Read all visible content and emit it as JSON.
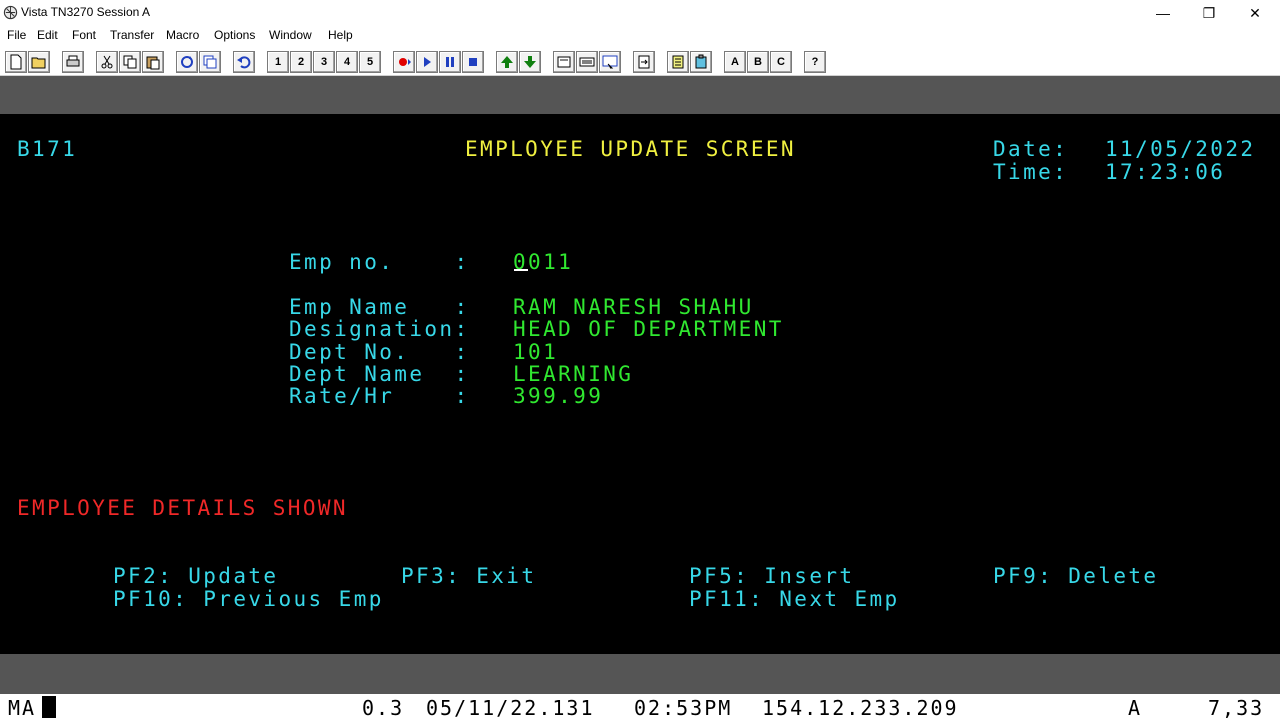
{
  "window": {
    "title": "Vista TN3270 Session A",
    "minimize": "—",
    "restore": "❐",
    "close": "✕"
  },
  "menu": [
    "File",
    "Edit",
    "Font",
    "Transfer",
    "Macro",
    "Options",
    "Window",
    "Help"
  ],
  "toolbar": {
    "macro_buttons": [
      "1",
      "2",
      "3",
      "4",
      "5"
    ],
    "letter_buttons": [
      "A",
      "B",
      "C"
    ],
    "help_button": "?"
  },
  "screen": {
    "transaction_id": "B171",
    "title": "EMPLOYEE UPDATE SCREEN",
    "date_label": "Date:",
    "date_value": "11/05/2022",
    "time_label": "Time:",
    "time_value": "17:23:06",
    "fields": [
      {
        "label": "Emp no.    :",
        "value": "0011"
      },
      {
        "label": "Emp Name   :",
        "value": "RAM NARESH SHAHU"
      },
      {
        "label": "Designation:",
        "value": "HEAD OF DEPARTMENT"
      },
      {
        "label": "Dept No.   :",
        "value": "101"
      },
      {
        "label": "Dept Name  :",
        "value": "LEARNING"
      },
      {
        "label": "Rate/Hr    :",
        "value": "399.99"
      }
    ],
    "message": "EMPLOYEE DETAILS SHOWN",
    "pf_keys": [
      "PF2: Update",
      "PF3: Exit",
      "PF5: Insert",
      "PF9: Delete",
      "PF10: Previous Emp",
      "PF11: Next Emp"
    ]
  },
  "status": {
    "indicator": "MA",
    "version": "0.3",
    "datestamp": "05/11/22.131",
    "clock": "02:53PM",
    "ip": "154.12.233.209",
    "mode": "A",
    "cursor_pos": "7,33"
  },
  "colors": {
    "terminal_bg": "#000000",
    "label": "#38d8e8",
    "title": "#f0f040",
    "value": "#30e830",
    "message": "#f02828"
  }
}
